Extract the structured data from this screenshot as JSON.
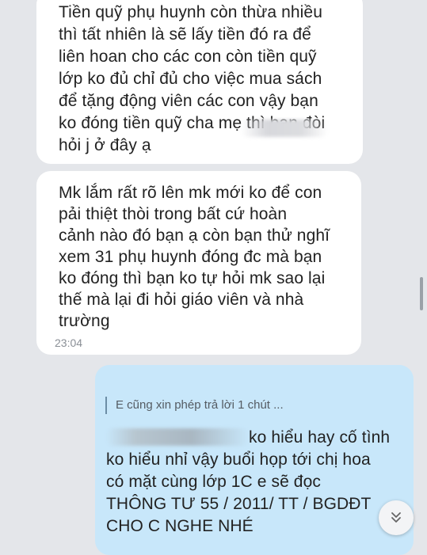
{
  "messages": {
    "first": {
      "lines": [
        "Tiền quỹ phụ huynh còn thừa nhiều",
        "thì tất nhiên là sẽ lấy tiền đó ra để",
        "liên hoan cho các con còn tiền quỹ",
        "lớp ko đủ chỉ đủ cho việc mua sách",
        "để tặng động viên các con vậy bạn",
        "ko đóng tiền quỹ cha mẹ thì bạn đòi",
        "hỏi j ở đây ạ"
      ]
    },
    "second": {
      "lines": [
        "Mk lắm rất rõ lên mk mới ko để con",
        "pải thiệt thòi trong bất cứ hoàn",
        "cảnh nào đó bạn ạ còn bạn thử nghĩ",
        "xem 31 phụ huynh đóng đc mà bạn",
        "ko đóng thì bạn ko tự hỏi mk sao lại",
        "thế mà lại đi hỏi giáo viên và nhà",
        "trường"
      ],
      "time": "23:04"
    },
    "reply": {
      "quote": "E cũng xin phép trả lời 1 chút ...",
      "lines": [
        "ko hiểu hay cố tình",
        "ko hiểu nhỉ vậy buổi họp tới chị hoa",
        "có mặt cùng lớp 1C e sẽ đọc",
        "THÔNG TƯ 55 / 2011/ TT / BGDĐT",
        "CHO C NGHE NHÉ"
      ]
    }
  },
  "colors": {
    "background": "#e4e6ea",
    "incoming_bubble": "#ffffff",
    "outgoing_bubble": "#c8e7fa",
    "text": "#222222"
  },
  "icons": {
    "scroll_down": "double-chevron-down-icon"
  }
}
